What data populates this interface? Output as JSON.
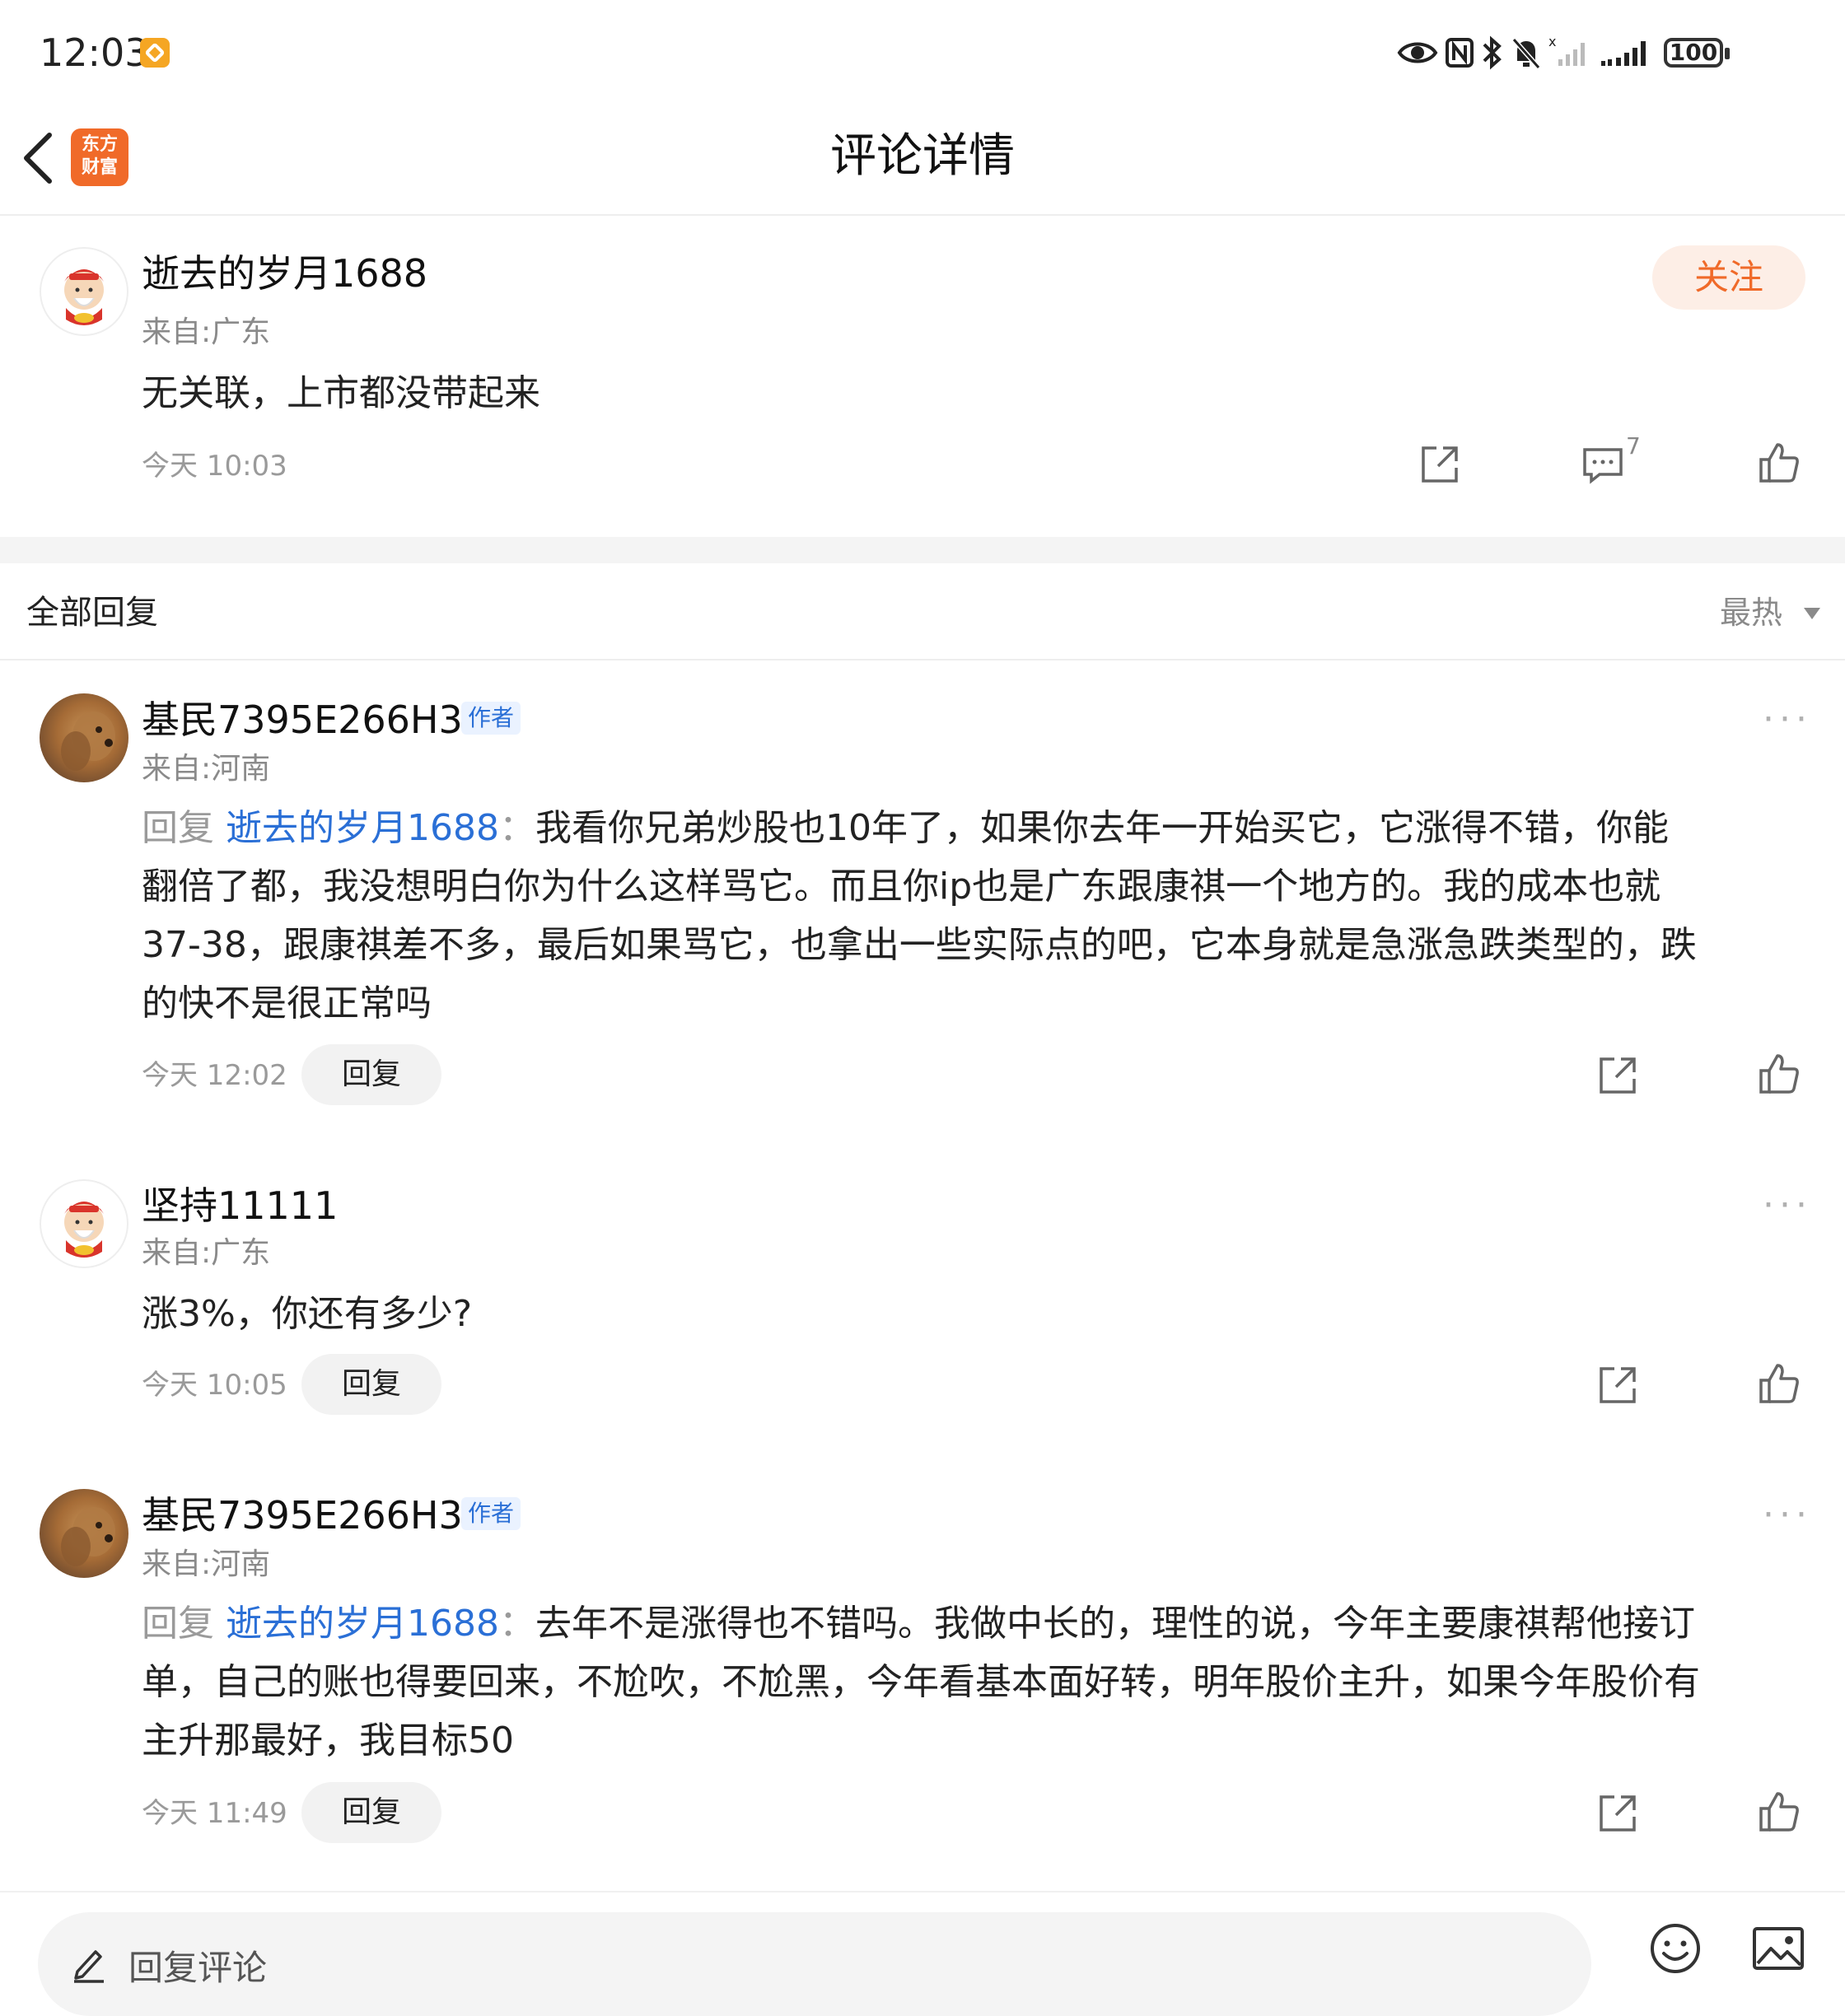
{
  "status_bar": {
    "time": "12:03",
    "battery": "100"
  },
  "header": {
    "title": "评论详情",
    "logo_line1": "东方",
    "logo_line2": "财富"
  },
  "main_comment": {
    "username": "逝去的岁月1688",
    "location": "来自:广东",
    "text": "无关联，上市都没带起来",
    "time": "今天 10:03",
    "follow_label": "关注",
    "comment_count": "7"
  },
  "replies_header": {
    "title": "全部回复",
    "sort": "最热"
  },
  "replies": [
    {
      "username": "基民7395E266H3",
      "tag": "作者",
      "location": "来自:河南",
      "reply_prefix": "回复",
      "reply_to": "逝去的岁月1688",
      "lines": [
        "我看你兄弟炒股也10年了，如果你去年一开始买它，它涨得不错，你能",
        "翻倍了都，我没想明白你为什么这样骂它。而且你ip也是广东跟康祺一个地方的。我的成本也就",
        "37-38，跟康祺差不多，最后如果骂它，也拿出一些实际点的吧，它本身就是急涨急跌类型的，跌",
        "的快不是很正常吗"
      ],
      "time": "今天 12:02",
      "reply_label": "回复"
    },
    {
      "username": "坚持11111",
      "location": "来自:广东",
      "text": "涨3%，你还有多少?",
      "time": "今天 10:05",
      "reply_label": "回复"
    },
    {
      "username": "基民7395E266H3",
      "tag": "作者",
      "location": "来自:河南",
      "reply_prefix": "回复",
      "reply_to": "逝去的岁月1688",
      "lines": [
        "去年不是涨得也不错吗。我做中长的，理性的说，今年主要康祺帮他接订",
        "单，自己的账也得要回来，不尬吹，不尬黑，今年看基本面好转，明年股价主升，如果今年股价有",
        "主升那最好，我目标50"
      ],
      "time": "今天 11:49",
      "reply_label": "回复"
    }
  ],
  "bottom_bar": {
    "placeholder": "回复评论"
  },
  "colors": {
    "accent": "#f06a29",
    "link": "#2a6fd6"
  }
}
